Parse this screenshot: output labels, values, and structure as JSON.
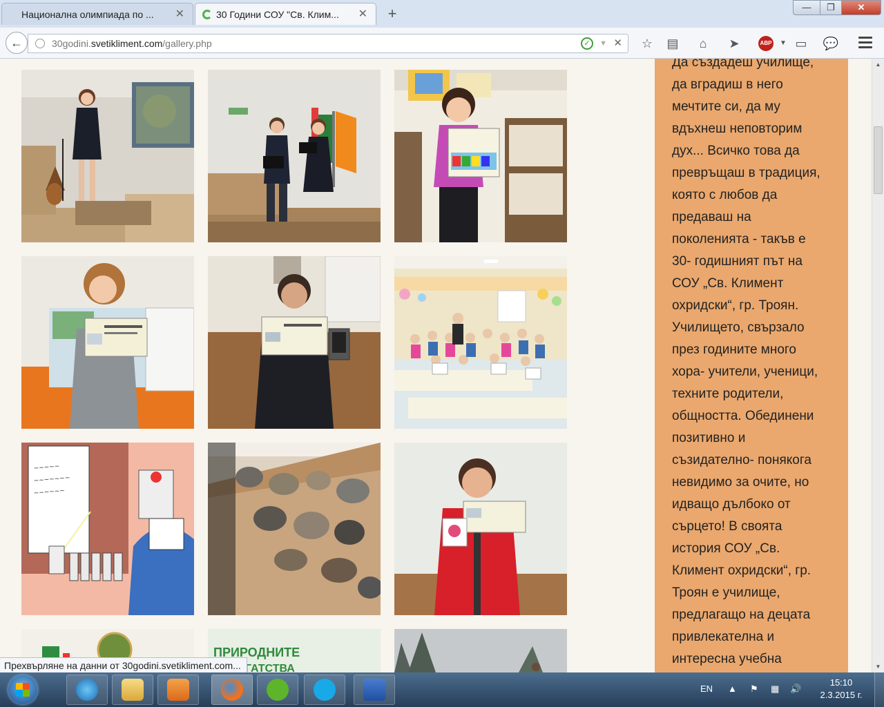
{
  "browser": {
    "tabs": [
      {
        "title": "Национална олимпиада по ...",
        "active": false
      },
      {
        "title": "30 Години СОУ \"Св. Клим...",
        "active": true
      }
    ],
    "new_tab": "+",
    "url_prefix": "30godini.",
    "url_host": "svetikliment.com",
    "url_path": "/gallery.php",
    "window_controls": {
      "minimize": "—",
      "maximize": "❐",
      "close": "✕"
    }
  },
  "gallery": {
    "photos": [
      {
        "scene": "singer-at-podium"
      },
      {
        "scene": "two-students-at-microphones"
      },
      {
        "scene": "girl-with-certificate-classroom"
      },
      {
        "scene": "girl-with-certificate-orange-wall"
      },
      {
        "scene": "boy-with-certificate"
      },
      {
        "scene": "class-group-photo"
      },
      {
        "scene": "cartoon-robot-drawing"
      },
      {
        "scene": "mineral-display"
      },
      {
        "scene": "boy-red-jacket-certificate"
      },
      {
        "scene": "logo-building"
      },
      {
        "scene": "green-sign"
      },
      {
        "scene": "trees-sky"
      }
    ],
    "sign_text_1": "ПРИРОДНИТЕ",
    "sign_text_2": "БОГАТСТВА"
  },
  "sidebar": {
    "lines": [
      "Да създадеш училище,",
      "да вградиш в него",
      "мечтите си, да му",
      "вдъхнеш неповторим",
      "дух... Всичко това да",
      "превръщаш в традиция,",
      "която с любов да",
      "предаваш на",
      "поколенията - такъв е",
      "30- годишният път на",
      "СОУ „Св. Климент",
      "охридски“, гр. Троян.",
      "Училището, свързало",
      "през годините много",
      "хора- учители, ученици,",
      "техните родители,",
      "общността. Обединени",
      "позитивно и",
      "съзидателно- понякога",
      "невидимо за очите, но",
      "идващо дълбоко от",
      "сърцето! В своята",
      "история СОУ „Св.",
      "Климент охридски“, гр.",
      "Троян е училище,",
      "предлагащо на децата",
      "привлекателна и",
      "интересна учебна"
    ],
    "bg_color": "#eaa86e"
  },
  "status": {
    "text": "Прехвърляне на данни от 30godini.svetikliment.com..."
  },
  "taskbar": {
    "apps": [
      "internet-explorer",
      "file-explorer",
      "media-player",
      "firefox",
      "utorrent",
      "skype",
      "word"
    ],
    "language": "EN",
    "time": "15:10",
    "date": "2.3.2015 г."
  }
}
